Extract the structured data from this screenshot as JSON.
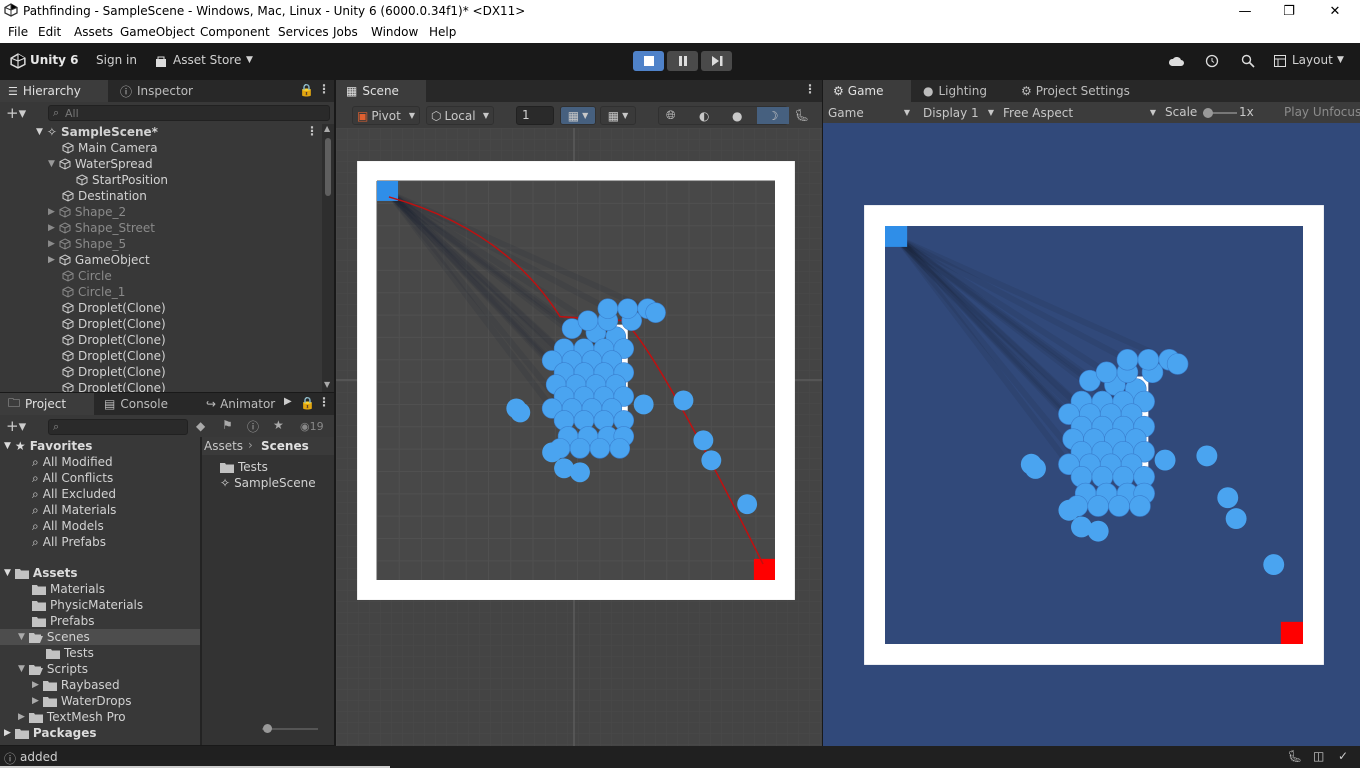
{
  "window": {
    "title": "Pathfinding - SampleScene - Windows, Mac, Linux - Unity 6 (6000.0.34f1)* <DX11>"
  },
  "menu": [
    "File",
    "Edit",
    "Assets",
    "GameObject",
    "Component",
    "Services",
    "Jobs",
    "Window",
    "Help"
  ],
  "toolbar": {
    "account": "Unity 6",
    "sign_in": "Sign in",
    "asset_store": "Asset Store",
    "layout": "Layout"
  },
  "hierarchy": {
    "tab": "Hierarchy",
    "tab2": "Inspector",
    "search_placeholder": "All",
    "items": [
      {
        "label": "SampleScene*"
      },
      {
        "label": "Main Camera"
      },
      {
        "label": "WaterSpread"
      },
      {
        "label": "StartPosition"
      },
      {
        "label": "Destination"
      },
      {
        "label": "Shape_2"
      },
      {
        "label": "Shape_Street"
      },
      {
        "label": "Shape_5"
      },
      {
        "label": "GameObject"
      },
      {
        "label": "Circle"
      },
      {
        "label": "Circle_1"
      },
      {
        "label": "Droplet(Clone)"
      },
      {
        "label": "Droplet(Clone)"
      },
      {
        "label": "Droplet(Clone)"
      },
      {
        "label": "Droplet(Clone)"
      },
      {
        "label": "Droplet(Clone)"
      },
      {
        "label": "Droplet(Clone)"
      }
    ]
  },
  "project": {
    "tabs": [
      "Project",
      "Console",
      "Animator"
    ],
    "hidden_count": "19",
    "favorites_label": "Favorites",
    "favorites": [
      "All Modified",
      "All Conflicts",
      "All Excluded",
      "All Materials",
      "All Models",
      "All Prefabs"
    ],
    "assets_label": "Assets",
    "tree": [
      {
        "label": "Materials"
      },
      {
        "label": "PhysicMaterials"
      },
      {
        "label": "Prefabs"
      },
      {
        "label": "Scenes"
      },
      {
        "label": "Tests"
      },
      {
        "label": "Scripts"
      },
      {
        "label": "Raybased"
      },
      {
        "label": "WaterDrops"
      },
      {
        "label": "TextMesh Pro"
      }
    ],
    "packages_label": "Packages",
    "breadcrumb": {
      "root": "Assets",
      "current": "Scenes"
    },
    "files": [
      {
        "label": "Tests",
        "icon": "folder-icon"
      },
      {
        "label": "SampleScene",
        "icon": "unity-scene-icon"
      }
    ]
  },
  "scene": {
    "tab": "Scene",
    "pivot": "Pivot",
    "local": "Local",
    "grid_size": "1"
  },
  "game": {
    "tabs": [
      "Game",
      "Lighting",
      "Project Settings"
    ],
    "mode": "Game",
    "display": "Display 1",
    "aspect": "Free Aspect",
    "scale_label": "Scale",
    "scale_value": "1x",
    "play_focus": "Play Unfocused"
  },
  "status": {
    "message": "added"
  },
  "colors": {
    "accent_blue": "#4aa4f0",
    "goal_red": "#ff0000",
    "game_bg": "#31497a",
    "path_red": "#c01010"
  }
}
